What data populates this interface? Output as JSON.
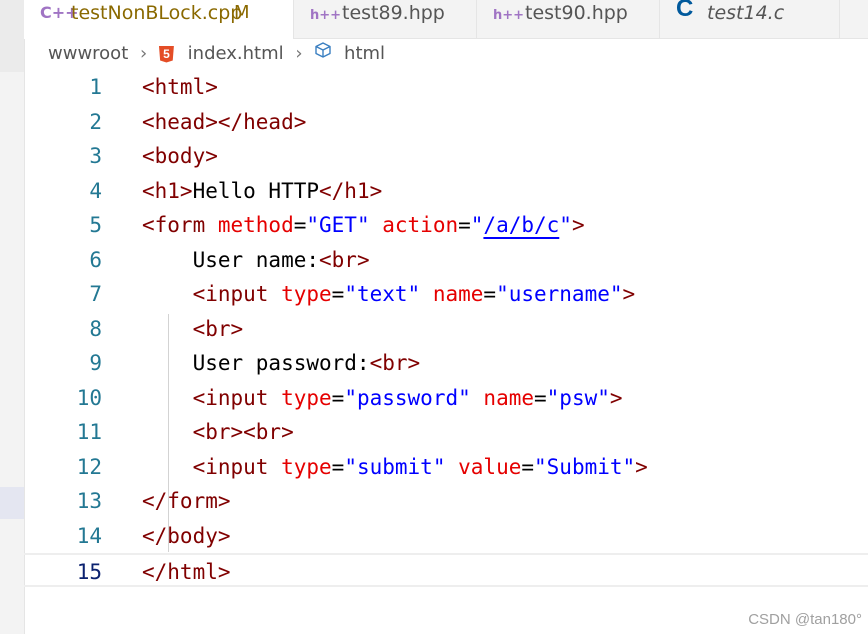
{
  "tabs": [
    {
      "icon": "C++",
      "label": "testNonBLock.cpp",
      "modified": "M"
    },
    {
      "icon": "h++",
      "label": "test89.hpp"
    },
    {
      "icon": "h++",
      "label": "test90.hpp"
    },
    {
      "icon": "C",
      "label": "test14.c"
    }
  ],
  "breadcrumb": {
    "folder": "wwwroot",
    "file": "index.html",
    "symbol": "html",
    "html5_badge": "5"
  },
  "editor": {
    "line_numbers": [
      "1",
      "2",
      "3",
      "4",
      "5",
      "6",
      "7",
      "8",
      "9",
      "10",
      "11",
      "12",
      "13",
      "14",
      "15"
    ],
    "current_line": "15",
    "lines": [
      [
        {
          "t": "tag",
          "v": "<html>"
        }
      ],
      [
        {
          "t": "tag",
          "v": "<head></head>"
        }
      ],
      [
        {
          "t": "tag",
          "v": "<body>"
        }
      ],
      [
        {
          "t": "tag",
          "v": "<h1>"
        },
        {
          "t": "txt",
          "v": "Hello HTTP"
        },
        {
          "t": "tag",
          "v": "</h1>"
        }
      ],
      [
        {
          "t": "tag",
          "v": "<form "
        },
        {
          "t": "attr",
          "v": "method"
        },
        {
          "t": "txt",
          "v": "="
        },
        {
          "t": "str",
          "v": "\"GET\""
        },
        {
          "t": "txt",
          "v": " "
        },
        {
          "t": "attr",
          "v": "action"
        },
        {
          "t": "txt",
          "v": "="
        },
        {
          "t": "str",
          "v": "\""
        },
        {
          "t": "link",
          "v": "/a/b/c"
        },
        {
          "t": "str",
          "v": "\""
        },
        {
          "t": "tag",
          "v": ">"
        }
      ],
      [
        {
          "t": "txt",
          "v": "    User name:"
        },
        {
          "t": "tag",
          "v": "<br>"
        }
      ],
      [
        {
          "t": "txt",
          "v": "    "
        },
        {
          "t": "tag",
          "v": "<input "
        },
        {
          "t": "attr",
          "v": "type"
        },
        {
          "t": "txt",
          "v": "="
        },
        {
          "t": "str",
          "v": "\"text\""
        },
        {
          "t": "txt",
          "v": " "
        },
        {
          "t": "attr",
          "v": "name"
        },
        {
          "t": "txt",
          "v": "="
        },
        {
          "t": "str",
          "v": "\"username\""
        },
        {
          "t": "tag",
          "v": ">"
        }
      ],
      [
        {
          "t": "txt",
          "v": "    "
        },
        {
          "t": "tag",
          "v": "<br>"
        }
      ],
      [
        {
          "t": "txt",
          "v": "    User password:"
        },
        {
          "t": "tag",
          "v": "<br>"
        }
      ],
      [
        {
          "t": "txt",
          "v": "    "
        },
        {
          "t": "tag",
          "v": "<input "
        },
        {
          "t": "attr",
          "v": "type"
        },
        {
          "t": "txt",
          "v": "="
        },
        {
          "t": "str",
          "v": "\"password\""
        },
        {
          "t": "txt",
          "v": " "
        },
        {
          "t": "attr",
          "v": "name"
        },
        {
          "t": "txt",
          "v": "="
        },
        {
          "t": "str",
          "v": "\"psw\""
        },
        {
          "t": "tag",
          "v": ">"
        }
      ],
      [
        {
          "t": "txt",
          "v": "    "
        },
        {
          "t": "tag",
          "v": "<br><br>"
        }
      ],
      [
        {
          "t": "txt",
          "v": "    "
        },
        {
          "t": "tag",
          "v": "<input "
        },
        {
          "t": "attr",
          "v": "type"
        },
        {
          "t": "txt",
          "v": "="
        },
        {
          "t": "str",
          "v": "\"submit\""
        },
        {
          "t": "txt",
          "v": " "
        },
        {
          "t": "attr",
          "v": "value"
        },
        {
          "t": "txt",
          "v": "="
        },
        {
          "t": "str",
          "v": "\"Submit\""
        },
        {
          "t": "tag",
          "v": ">"
        }
      ],
      [
        {
          "t": "tag",
          "v": "</form>"
        }
      ],
      [
        {
          "t": "tag",
          "v": "</body>"
        }
      ],
      [
        {
          "t": "tag",
          "v": "</html>"
        }
      ]
    ]
  },
  "colors": {
    "tag": "#800000",
    "attribute": "#e50000",
    "string": "#0000ff",
    "line_number": "#237893",
    "modified_tab": "#8a6900"
  },
  "watermark": "CSDN @tan180°"
}
